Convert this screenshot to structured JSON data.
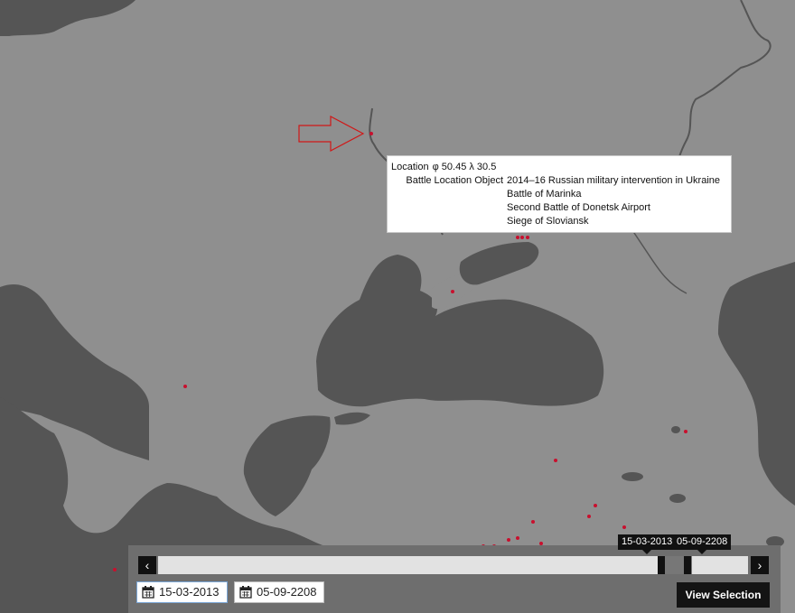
{
  "tooltip": {
    "location_label": "Location",
    "location_value": "φ 50.45 λ 30.5",
    "battle_label": "Battle Location Object",
    "battles": [
      "2014–16 Russian military intervention in Ukraine",
      "Battle of Marinka",
      "Second Battle of Donetsk Airport",
      "Siege of Sloviansk"
    ]
  },
  "timeline": {
    "prev_icon": "chevron-left-icon",
    "next_icon": "chevron-right-icon",
    "prev_glyph": "‹",
    "next_glyph": "›",
    "start_label": "15-03-2013",
    "end_label": "05-09-2208",
    "start_input": "15-03-2013",
    "end_input": "05-09-2208",
    "view_button": "View Selection"
  },
  "colors": {
    "land": "#8f8f8f",
    "water": "#545454",
    "marker": "#c8102e",
    "arrow": "#d01818"
  }
}
